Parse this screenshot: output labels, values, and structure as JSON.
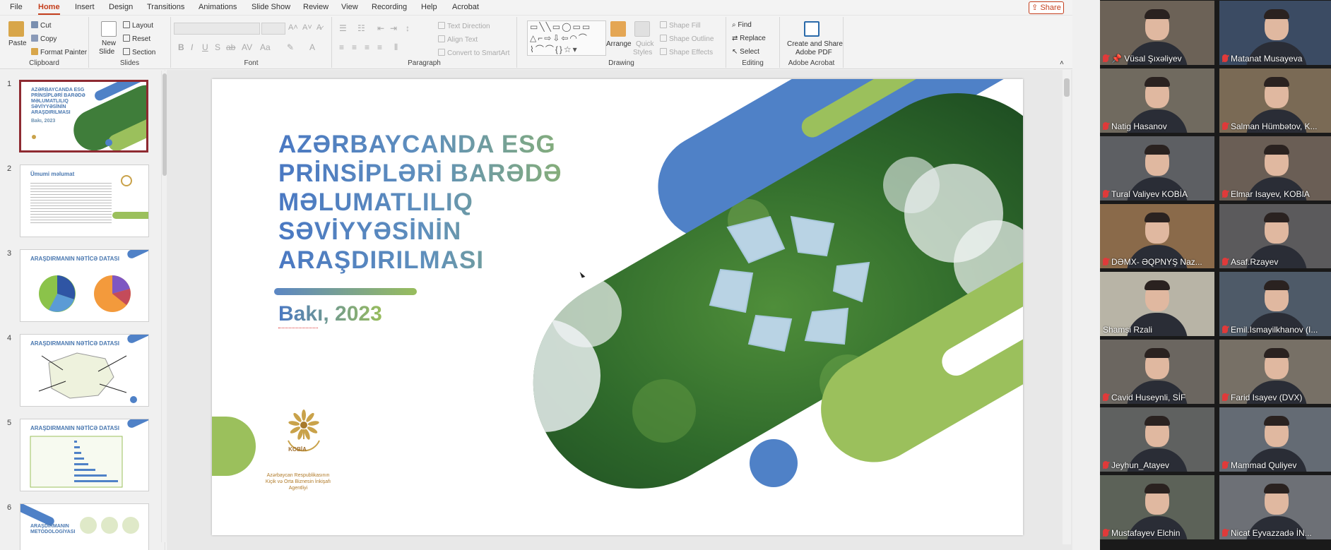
{
  "menu": {
    "tabs": [
      {
        "label": "File"
      },
      {
        "label": "Home"
      },
      {
        "label": "Insert"
      },
      {
        "label": "Design"
      },
      {
        "label": "Transitions"
      },
      {
        "label": "Animations"
      },
      {
        "label": "Slide Show"
      },
      {
        "label": "Review"
      },
      {
        "label": "View"
      },
      {
        "label": "Recording"
      },
      {
        "label": "Help"
      },
      {
        "label": "Acrobat"
      }
    ],
    "share_label": "Share"
  },
  "ribbon": {
    "clipboard": {
      "paste": "Paste",
      "cut": "Cut",
      "copy": "Copy",
      "format_painter": "Format Painter",
      "label": "Clipboard"
    },
    "slides": {
      "new_slide": "New",
      "new_slide_2": "Slide",
      "layout": "Layout",
      "reset": "Reset",
      "section": "Section",
      "label": "Slides"
    },
    "font": {
      "label": "Font"
    },
    "paragraph": {
      "text_direction": "Text Direction",
      "align_text": "Align Text",
      "convert_smartart": "Convert to SmartArt",
      "label": "Paragraph"
    },
    "drawing": {
      "arrange": "Arrange",
      "quick_styles": "Quick",
      "quick_styles_2": "Styles",
      "shape_fill": "Shape Fill",
      "shape_outline": "Shape Outline",
      "shape_effects": "Shape Effects",
      "label": "Drawing"
    },
    "editing": {
      "find": "Find",
      "replace": "Replace",
      "select": "Select",
      "label": "Editing"
    },
    "acrobat": {
      "create_share": "Create and Share",
      "adobe_pdf": "Adobe PDF",
      "label": "Adobe Acrobat"
    }
  },
  "thumbnails": [
    {
      "number": "1",
      "title": "AZƏRBAYCANDA ESG PRİNSİPLƏRİ BARƏDƏ MƏLUMATLILIQ SƏVİYYƏSİNİN ARAŞDIRILMASI"
    },
    {
      "number": "2",
      "title": "Ümumi məlumat"
    },
    {
      "number": "3",
      "title": "ARAŞDIRMANIN NƏTİCƏ DATASI"
    },
    {
      "number": "4",
      "title": "ARAŞDIRMANIN NƏTİCƏ DATASI"
    },
    {
      "number": "5",
      "title": "ARAŞDIRMANIN NƏTİCƏ DATASI"
    },
    {
      "number": "6",
      "title": "ARAŞDIRMANIN METODOLOGİYASI"
    }
  ],
  "slide": {
    "title": "AZƏRBAYCANDA ESG\nPRİNSİPLƏRİ BARƏDƏ\nMƏLUMATLILIQ\nSƏVİYYƏSİNİN\nARAŞDIRILMASI",
    "date": "Bakı, 2023",
    "logo_text": "KOBİA",
    "org_name": "Azərbaycan Respublikasının Kiçik və Orta Biznesin İnkişafı Agentliyi",
    "colors": {
      "blue": "#4f81c7",
      "green": "#9bc05c"
    }
  },
  "participants": [
    {
      "name": "Vüsal Şıxəliyev",
      "muted": true,
      "pinned": true
    },
    {
      "name": "Matanat Musayeva",
      "muted": true
    },
    {
      "name": "Natig Hasanov",
      "muted": true
    },
    {
      "name": "Salman Hümbətov, K...",
      "muted": true
    },
    {
      "name": "Tural Valiyev KOBİA",
      "muted": true
    },
    {
      "name": "Elmar Isayev, KOBIA",
      "muted": true
    },
    {
      "name": "DƏMX- ƏQPNYŞ Naz...",
      "muted": true
    },
    {
      "name": "Asaf.Rzayev",
      "muted": true
    },
    {
      "name": "Shamsi Rzali",
      "muted": false,
      "active": true
    },
    {
      "name": "Emil.Ismayilkhanov (I...",
      "muted": true
    },
    {
      "name": "Cavid Huseynli, SİF",
      "muted": true
    },
    {
      "name": "Farid Isayev (DVX)",
      "muted": true
    },
    {
      "name": "Jeyhun_Atayev",
      "muted": true
    },
    {
      "name": "Mammad Quliyev",
      "muted": true
    },
    {
      "name": "Mustafayev Elchin",
      "muted": true
    },
    {
      "name": "Nicat Eyvazzadə İN...",
      "muted": true
    }
  ]
}
